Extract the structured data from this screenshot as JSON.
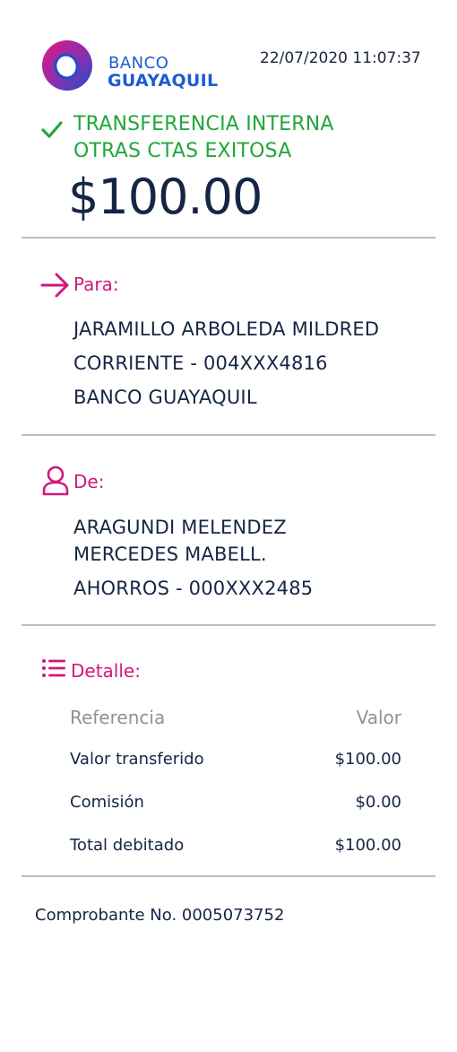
{
  "header": {
    "brand_line1": "BANCO",
    "brand_line2": "GUAYAQUIL",
    "timestamp": "22/07/2020 11:07:37",
    "logo_icon": "banco-guayaquil-logo",
    "brand_color": "#1e5bd1"
  },
  "status": {
    "icon": "check-icon",
    "line1": "TRANSFERENCIA INTERNA",
    "line2": "OTRAS CTAS EXITOSA",
    "color": "#1fa83a"
  },
  "amount": "$100.00",
  "para": {
    "icon": "arrow-right-icon",
    "label": "Para:",
    "name": "JARAMILLO ARBOLEDA MILDRED",
    "account": "CORRIENTE - 004XXX4816",
    "bank": "BANCO GUAYAQUIL"
  },
  "de": {
    "icon": "user-icon",
    "label": "De:",
    "name_line1": "ARAGUNDI MELENDEZ",
    "name_line2": "MERCEDES MABELL.",
    "account": "AHORROS - 000XXX2485"
  },
  "detalle": {
    "icon": "list-icon",
    "label": "Detalle:",
    "columns": [
      "Referencia",
      "Valor"
    ],
    "rows": [
      {
        "ref": "Valor transferido",
        "valor": "$100.00"
      },
      {
        "ref": "Comisión",
        "valor": "$0.00"
      },
      {
        "ref": "Total debitado",
        "valor": "$100.00"
      }
    ]
  },
  "footer": {
    "comprobante": "Comprobante No. 0005073752"
  },
  "colors": {
    "accent": "#d0197d",
    "text": "#152545",
    "muted": "#8a939c"
  }
}
